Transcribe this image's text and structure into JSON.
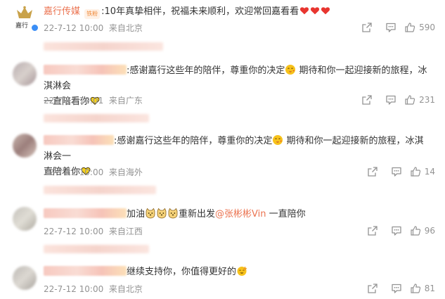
{
  "comments": [
    {
      "author": "嘉行传媒",
      "author_badge": "铁粉",
      "avatar_label": "嘉行",
      "text": ":10年真挚相伴，祝福未来顺利，欢迎常回嘉看看",
      "time": "22-7-12 10:00",
      "location": "来自北京",
      "likes": "590"
    },
    {
      "text_line1": ":感谢嘉行这些年的陪伴，尊重你的决定",
      "text_line1b": "期待和你一起迎接新的旅程，冰淇淋会",
      "text_line2": "一直陪看你",
      "time": "22-7-12 10:01",
      "location": "来自广东",
      "likes": "231"
    },
    {
      "text_line1": ":感谢嘉行这些年的陪伴，尊重你的决定",
      "text_line1b": "期待和你一起迎接新的旅程，冰淇淋会一",
      "text_line2": "直陪着你",
      "time": "22-7-12 10:00",
      "location": "来自海外",
      "likes": "14"
    },
    {
      "text_a": "加油",
      "text_b": "重新出发",
      "mention": "@张彬彬Vin",
      "text_c": "一直陪你",
      "time": "22-7-12 10:00",
      "location": "来自江西",
      "likes": "96"
    },
    {
      "text": "继续支持你，你值得更好的",
      "time": "22-7-12 10:00",
      "location": "来自北京",
      "likes": "81"
    }
  ],
  "icons": {
    "share": "share-icon",
    "comment": "comment-icon",
    "like": "thumbs-up-icon",
    "heart": "heart-emoji-icon",
    "face": "face-emoji-icon"
  },
  "colors": {
    "author": "#eb7350",
    "meta": "#939393",
    "heart": "#e8352f",
    "emoji_yellow": "#f7c21b"
  }
}
